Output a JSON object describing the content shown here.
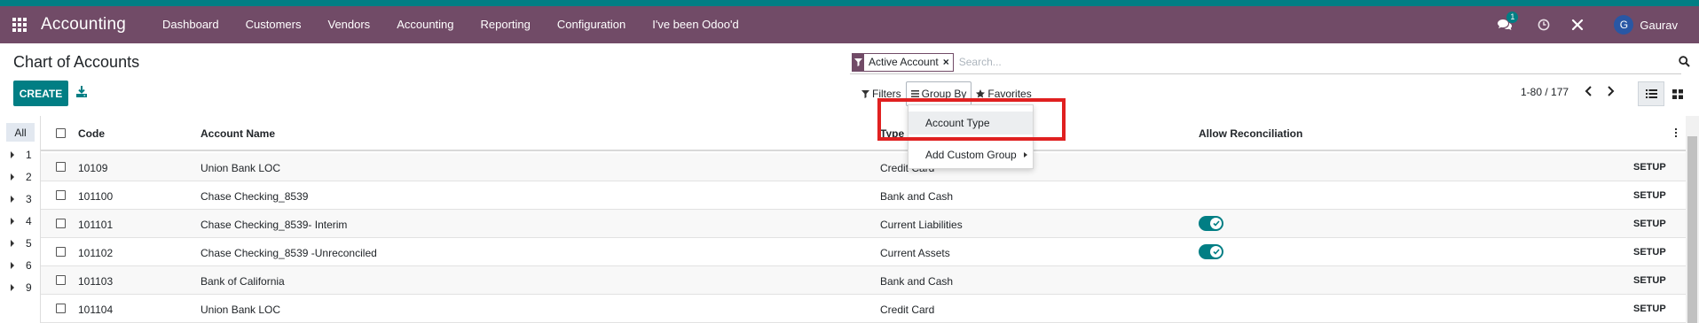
{
  "navbar": {
    "brand": "Accounting",
    "menu": [
      "Dashboard",
      "Customers",
      "Vendors",
      "Accounting",
      "Reporting",
      "Configuration",
      "I've been Odoo'd"
    ],
    "chat_count": "1",
    "user_initial": "G",
    "user_name": "Gaurav"
  },
  "control_panel": {
    "title": "Chart of Accounts",
    "create_label": "CREATE",
    "facet_label": "Active Account",
    "facet_remove": "×",
    "search_placeholder": "Search...",
    "filters_label": "Filters",
    "groupby_label": "Group By",
    "favorites_label": "Favorites",
    "pager": "1-80 / 177"
  },
  "groupby_menu": {
    "items": [
      "Account Type",
      "Add Custom Group"
    ]
  },
  "sidebar": {
    "all_label": "All",
    "items": [
      "1",
      "2",
      "3",
      "4",
      "5",
      "6",
      "9"
    ]
  },
  "table": {
    "headers": {
      "code": "Code",
      "name": "Account Name",
      "type": "Type",
      "reconcile": "Allow Reconciliation"
    },
    "rows": [
      {
        "code": "10109",
        "name": "Union Bank LOC",
        "type": "Credit Card",
        "reconcile": false,
        "action": "SETUP"
      },
      {
        "code": "101100",
        "name": "Chase Checking_8539",
        "type": "Bank and Cash",
        "reconcile": false,
        "action": "SETUP"
      },
      {
        "code": "101101",
        "name": "Chase Checking_8539- Interim",
        "type": "Current Liabilities",
        "reconcile": true,
        "action": "SETUP"
      },
      {
        "code": "101102",
        "name": "Chase Checking_8539 -Unreconciled",
        "type": "Current Assets",
        "reconcile": true,
        "action": "SETUP"
      },
      {
        "code": "101103",
        "name": "Bank of California",
        "type": "Bank and Cash",
        "reconcile": false,
        "action": "SETUP"
      },
      {
        "code": "101104",
        "name": "Union Bank LOC",
        "type": "Credit Card",
        "reconcile": false,
        "action": "SETUP"
      }
    ]
  },
  "colors": {
    "navbar": "#714b67",
    "primary": "#017e84",
    "highlight": "#e02020"
  }
}
